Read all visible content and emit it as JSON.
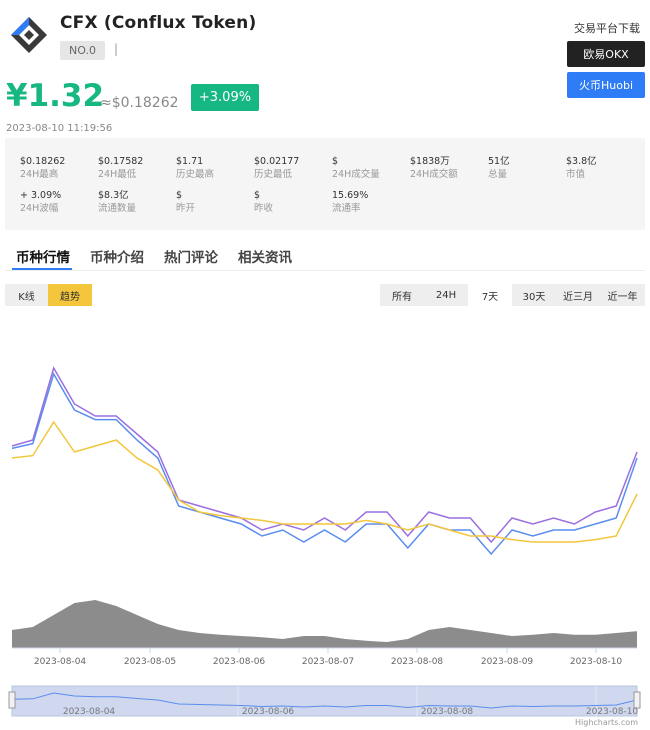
{
  "header": {
    "coin_name": "CFX (Conflux Token)",
    "rank": "NO.0",
    "separator": "|",
    "price_cny": "¥1.32",
    "price_usd": "≈$0.18262",
    "change": "+3.09%",
    "timestamp": "2023-08-10 11:19:56"
  },
  "download": {
    "title": "交易平台下载",
    "okx": "欧易OKX",
    "huobi": "火币Huobi"
  },
  "stats": [
    {
      "value": "$0.18262",
      "label": "24H最高"
    },
    {
      "value": "$0.17582",
      "label": "24H最低"
    },
    {
      "value": "$1.71",
      "label": "历史最高"
    },
    {
      "value": "$0.02177",
      "label": "历史最低"
    },
    {
      "value": "$",
      "label": "24H成交量"
    },
    {
      "value": "$1838万",
      "label": "24H成交额"
    },
    {
      "value": "51亿",
      "label": "总量"
    },
    {
      "value": "$3.8亿",
      "label": "市值"
    },
    {
      "value": "+ 3.09%",
      "label": "24H波幅"
    },
    {
      "value": "$8.3亿",
      "label": "流通数量"
    },
    {
      "value": "$",
      "label": "昨开"
    },
    {
      "value": "$",
      "label": "昨收"
    },
    {
      "value": "15.69%",
      "label": "流通率"
    }
  ],
  "tabs": [
    "币种行情",
    "币种介绍",
    "热门评论",
    "相关资讯"
  ],
  "chart_mode": {
    "kline": "K线",
    "trend": "趋势"
  },
  "ranges": [
    "所有",
    "24H",
    "7天",
    "30天",
    "近三月",
    "近一年"
  ],
  "selected_range": "7天",
  "credit": "Highcharts.com",
  "chart_data": {
    "type": "line",
    "x_ticks": [
      "2023-08-04",
      "2023-08-05",
      "2023-08-06",
      "2023-08-07",
      "2023-08-08",
      "2023-08-09",
      "2023-08-10"
    ],
    "navigator_ticks": [
      "2023-08-04",
      "2023-08-06",
      "2023-08-08",
      "2023-08-10"
    ],
    "series": [
      {
        "color": "#9b6fe0",
        "values": [
          0.2,
          0.25,
          0.85,
          0.55,
          0.45,
          0.45,
          0.3,
          0.15,
          -0.25,
          -0.3,
          -0.35,
          -0.4,
          -0.5,
          -0.45,
          -0.5,
          -0.4,
          -0.5,
          -0.35,
          -0.35,
          -0.55,
          -0.35,
          -0.4,
          -0.4,
          -0.6,
          -0.4,
          -0.45,
          -0.4,
          -0.45,
          -0.35,
          -0.3,
          0.15
        ]
      },
      {
        "color": "#5b8def",
        "values": [
          0.18,
          0.22,
          0.8,
          0.5,
          0.42,
          0.42,
          0.25,
          0.1,
          -0.3,
          -0.35,
          -0.4,
          -0.45,
          -0.55,
          -0.5,
          -0.6,
          -0.5,
          -0.6,
          -0.45,
          -0.45,
          -0.65,
          -0.45,
          -0.5,
          -0.5,
          -0.7,
          -0.5,
          -0.55,
          -0.5,
          -0.5,
          -0.45,
          -0.4,
          0.1
        ]
      },
      {
        "color": "#f4c63b",
        "values": [
          0.1,
          0.12,
          0.4,
          0.15,
          0.2,
          0.25,
          0.1,
          0.0,
          -0.25,
          -0.35,
          -0.38,
          -0.4,
          -0.42,
          -0.45,
          -0.45,
          -0.45,
          -0.45,
          -0.42,
          -0.45,
          -0.5,
          -0.45,
          -0.5,
          -0.55,
          -0.55,
          -0.58,
          -0.6,
          -0.6,
          -0.6,
          -0.58,
          -0.55,
          -0.2
        ]
      }
    ],
    "volume": [
      0.3,
      0.35,
      0.55,
      0.75,
      0.8,
      0.7,
      0.55,
      0.4,
      0.3,
      0.25,
      0.22,
      0.2,
      0.18,
      0.15,
      0.2,
      0.2,
      0.15,
      0.12,
      0.1,
      0.15,
      0.3,
      0.35,
      0.3,
      0.25,
      0.2,
      0.22,
      0.25,
      0.22,
      0.22,
      0.25,
      0.28
    ]
  }
}
